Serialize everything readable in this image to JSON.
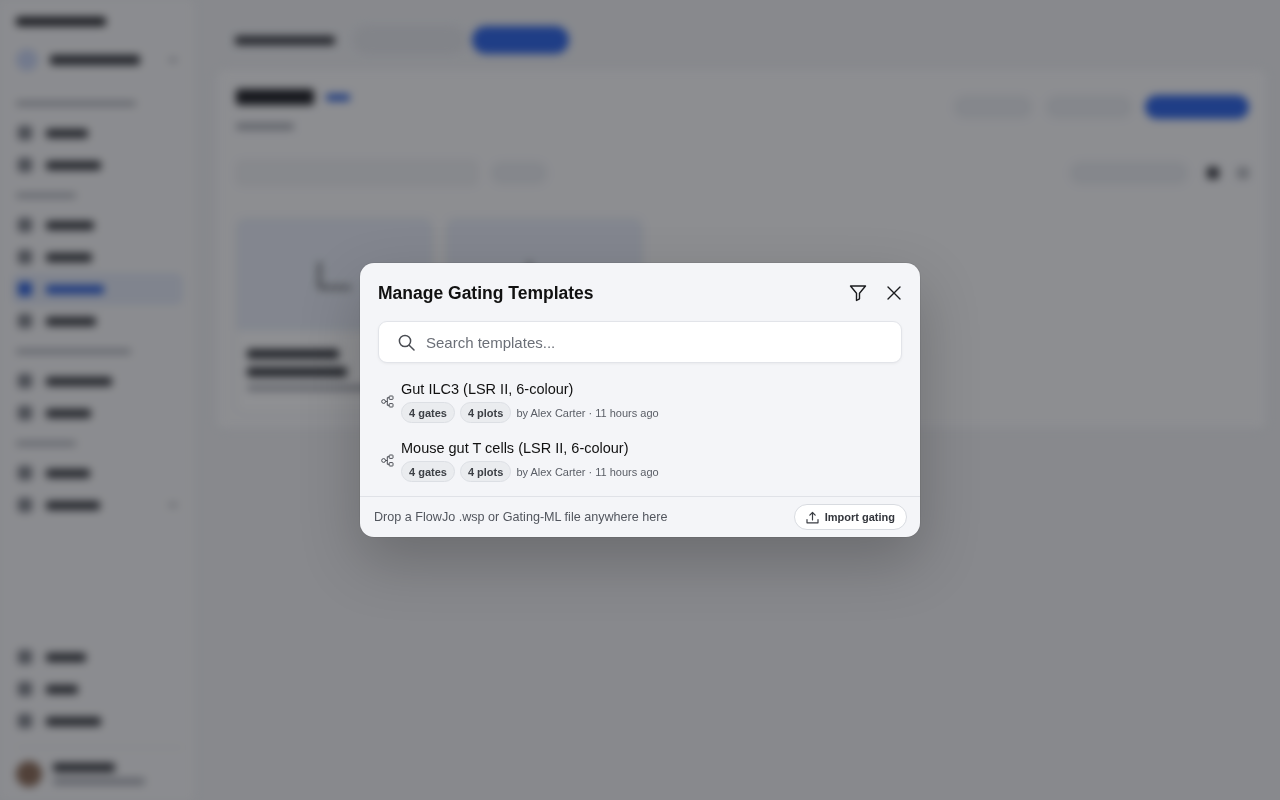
{
  "modal": {
    "title": "Manage Gating Templates",
    "search": {
      "placeholder": "Search templates..."
    },
    "templates": [
      {
        "name": "Gut ILC3 (LSR II, 6-colour)",
        "tags": [
          "4 gates",
          "4 plots"
        ],
        "meta": "by Alex Carter · 11 hours ago"
      },
      {
        "name": "Mouse gut T cells (LSR II, 6-colour)",
        "tags": [
          "4 gates",
          "4 plots"
        ],
        "meta": "by Alex Carter · 11 hours ago"
      }
    ],
    "footer": {
      "hint": "Drop a FlowJo .wsp or Gating-ML file anywhere here",
      "import_button": "Import gating"
    }
  }
}
